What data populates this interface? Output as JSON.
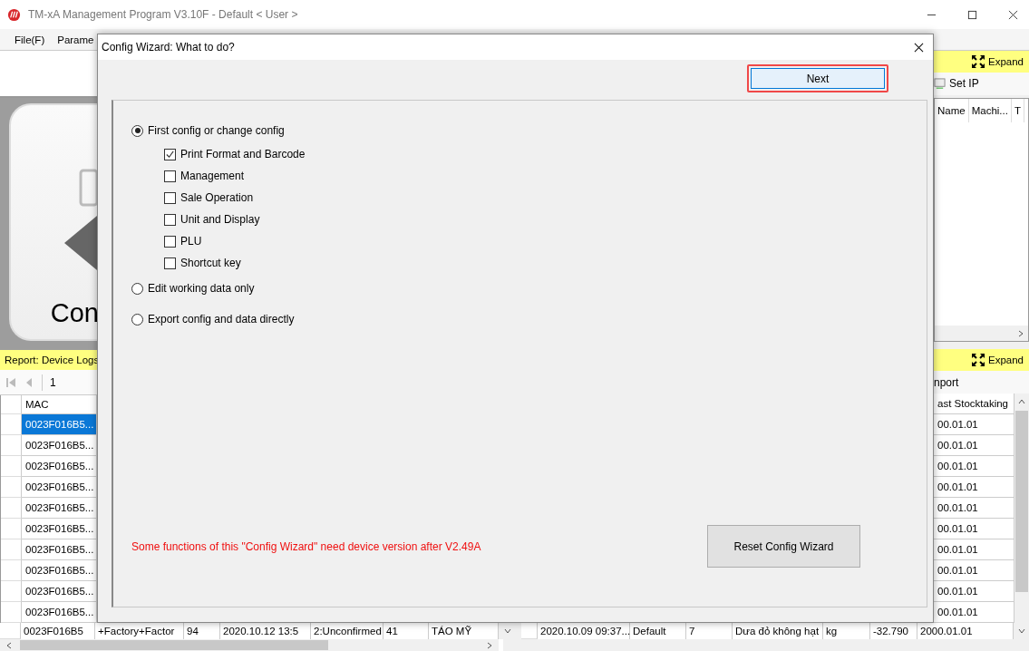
{
  "window": {
    "title": "TM-xA Management Program V3.10F - Default < User >"
  },
  "menu": [
    "File(F)",
    "Parame"
  ],
  "left": {
    "card_text": "Con",
    "report_title": "Report: Device Logs",
    "page": "1",
    "columns": [
      "MAC"
    ],
    "rows": [
      {
        "cells": [
          "0023F016B5..."
        ],
        "selected": true
      },
      {
        "cells": [
          "0023F016B5..."
        ],
        "selected": false
      },
      {
        "cells": [
          "0023F016B5..."
        ],
        "selected": false
      },
      {
        "cells": [
          "0023F016B5..."
        ],
        "selected": false
      },
      {
        "cells": [
          "0023F016B5..."
        ],
        "selected": false
      },
      {
        "cells": [
          "0023F016B5..."
        ],
        "selected": false
      },
      {
        "cells": [
          "0023F016B5..."
        ],
        "selected": false
      },
      {
        "cells": [
          "0023F016B5..."
        ],
        "selected": false
      },
      {
        "cells": [
          "0023F016B5..."
        ],
        "selected": false
      },
      {
        "cells": [
          "0023F016B5..."
        ],
        "selected": false
      }
    ],
    "last_row": [
      "0023F016B5",
      "+Factory+Factor",
      "94",
      "2020.10.12 13:5",
      "2:Unconfirmed",
      "41",
      "TÁO MỸ"
    ]
  },
  "right": {
    "top": {
      "expand": "Expand",
      "tool": "Set IP",
      "columns": [
        "Name",
        "Machi...",
        "T"
      ]
    },
    "bottom": {
      "expand": "Expand",
      "tool": "nport",
      "columns": [
        "ast Stocktaking"
      ],
      "rows": [
        "00.01.01",
        "00.01.01",
        "00.01.01",
        "00.01.01",
        "00.01.01",
        "00.01.01",
        "00.01.01",
        "00.01.01",
        "00.01.01",
        "00.01.01"
      ],
      "last_row": [
        "2020.10.09 09:37...",
        "Default",
        "7",
        "Dưa đỏ không hạt",
        "kg",
        "-32.790",
        "2000.01.01"
      ]
    }
  },
  "dialog": {
    "title": "Config Wizard: What to do?",
    "next": "Next",
    "next_highlighted": true,
    "options": [
      {
        "label": "First config or change config",
        "selected": true,
        "children": [
          {
            "label": "Print Format and Barcode",
            "checked": true
          },
          {
            "label": "Management",
            "checked": false
          },
          {
            "label": "Sale Operation",
            "checked": false
          },
          {
            "label": "Unit and Display",
            "checked": false
          },
          {
            "label": "PLU",
            "checked": false
          },
          {
            "label": "Shortcut key",
            "checked": false
          }
        ]
      },
      {
        "label": "Edit working data only",
        "selected": false
      },
      {
        "label": "Export config and data directly",
        "selected": false
      }
    ],
    "note": "Some functions of this \"Config Wizard\" need device version after V2.49A",
    "reset": "Reset Config Wizard"
  }
}
